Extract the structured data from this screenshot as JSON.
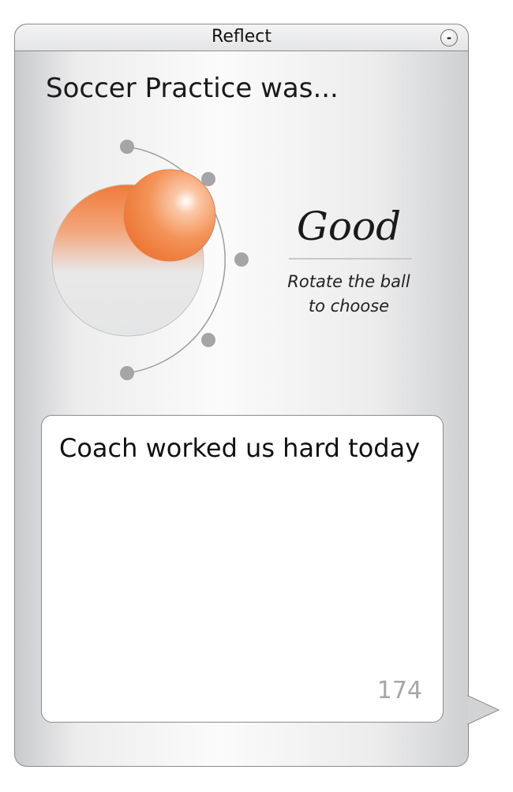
{
  "window": {
    "title": "Reflect",
    "minimize_label": "-"
  },
  "prompt": {
    "text": "Soccer Practice was..."
  },
  "rating": {
    "selected_label": "Good",
    "hint_line1": "Rotate the ball",
    "hint_line2": "to choose",
    "steps_total": 5,
    "selected_step": 2,
    "accent_color": "#f07a3a"
  },
  "note": {
    "text": "Coach worked us hard today",
    "char_count": "174"
  }
}
